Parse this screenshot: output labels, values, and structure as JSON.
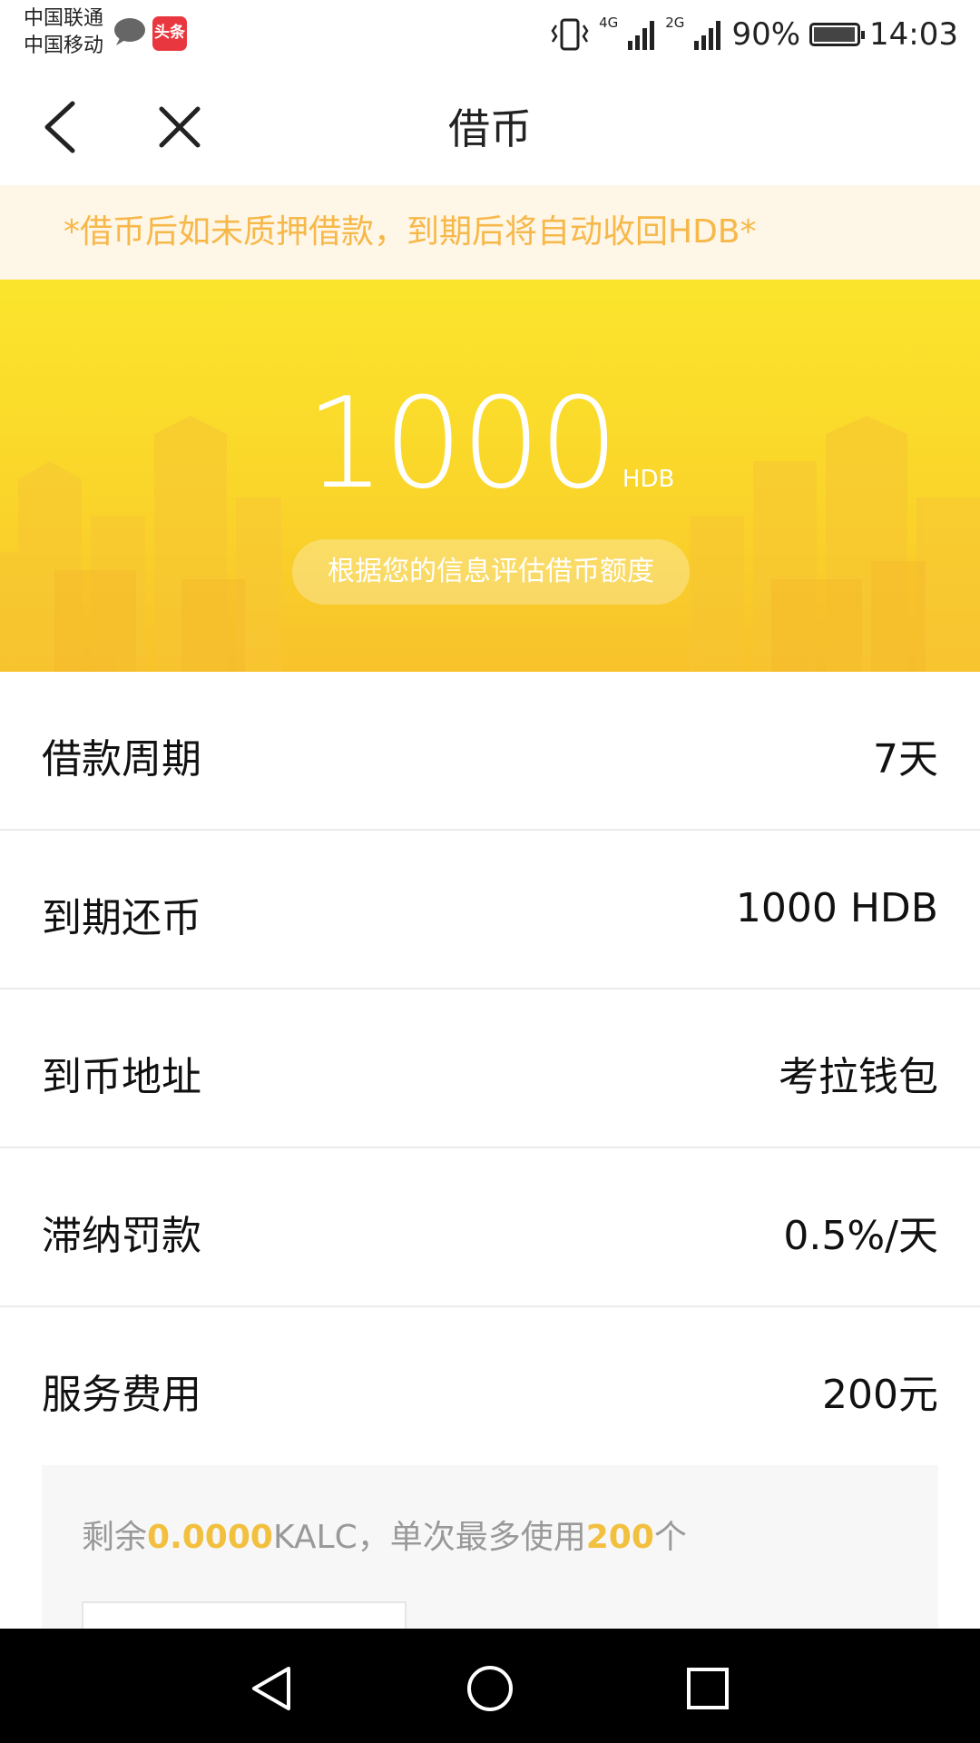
{
  "status_bar": {
    "carrier1": "中国联通",
    "carrier2": "中国移动",
    "app_badge": "头条",
    "net1": "4G",
    "net2": "2G",
    "battery": "90%",
    "time": "14:03"
  },
  "nav": {
    "title": "借币"
  },
  "notice": "*借币后如未质押借款，到期后将自动收回HDB*",
  "banner": {
    "amount": "1000",
    "unit": "HDB",
    "assess_label": "根据您的信息评估借币额度"
  },
  "details": [
    {
      "label": "借款周期",
      "value": "7天"
    },
    {
      "label": "到期还币",
      "value": "1000 HDB"
    },
    {
      "label": "到币地址",
      "value": "考拉钱包"
    },
    {
      "label": "滞纳罚款",
      "value": "0.5%/天"
    },
    {
      "label": "服务费用",
      "value": "200元"
    }
  ],
  "kalc": {
    "prefix": "剩余",
    "balance": "0.0000",
    "mid": "KALC，单次最多使用",
    "max": "200",
    "suffix": "个"
  },
  "colors": {
    "notice_bg": "#fef6e6",
    "notice_text": "#f7b84a",
    "banner_top": "#fbe52c",
    "banner_bottom": "#f8c22b",
    "highlight": "#f2c03e"
  },
  "icons": {
    "back": "chevron-left-icon",
    "close": "close-icon",
    "sys_back": "triangle-back-icon",
    "sys_home": "circle-home-icon",
    "sys_recent": "square-recent-icon"
  }
}
